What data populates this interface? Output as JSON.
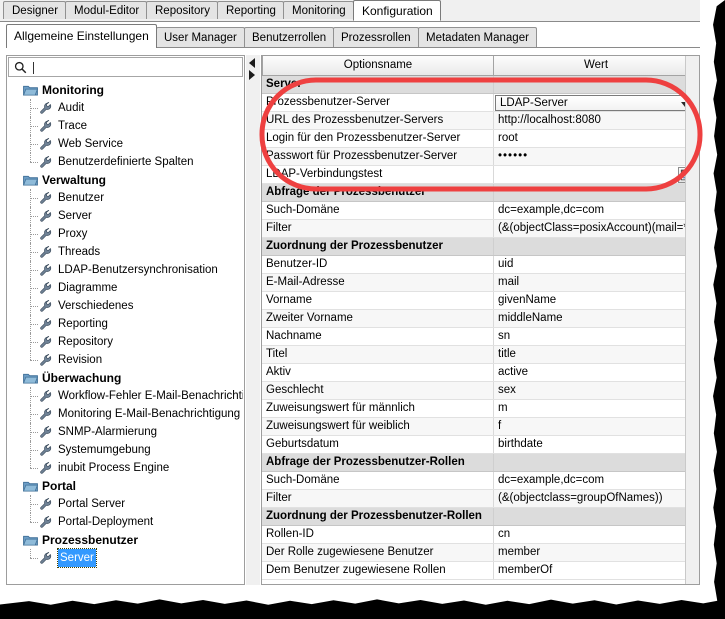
{
  "window": {
    "main_tabs": [
      {
        "label": "Designer",
        "active": false
      },
      {
        "label": "Modul-Editor",
        "active": false
      },
      {
        "label": "Repository",
        "active": false
      },
      {
        "label": "Reporting",
        "active": false
      },
      {
        "label": "Monitoring",
        "active": false
      },
      {
        "label": "Konfiguration",
        "active": true
      }
    ],
    "sub_tabs": [
      {
        "label": "Allgemeine Einstellungen",
        "active": true
      },
      {
        "label": "User Manager",
        "active": false
      },
      {
        "label": "Benutzerrollen",
        "active": false
      },
      {
        "label": "Prozessrollen",
        "active": false
      },
      {
        "label": "Metadaten Manager",
        "active": false
      }
    ]
  },
  "sidebar": {
    "search": {
      "value": "",
      "placeholder": "",
      "icon": "search-icon"
    },
    "splitter": {
      "collapse_left_icon": "triangle-left-icon",
      "collapse_right_icon": "triangle-right-icon"
    },
    "tree": [
      {
        "label": "Monitoring",
        "type": "folder",
        "selected": false
      },
      {
        "label": "Audit",
        "type": "leaf",
        "selected": false
      },
      {
        "label": "Trace",
        "type": "leaf",
        "selected": false
      },
      {
        "label": "Web Service",
        "type": "leaf",
        "selected": false
      },
      {
        "label": "Benutzerdefinierte Spalten",
        "type": "leaf",
        "selected": false
      },
      {
        "label": "Verwaltung",
        "type": "folder",
        "selected": false
      },
      {
        "label": "Benutzer",
        "type": "leaf",
        "selected": false
      },
      {
        "label": "Server",
        "type": "leaf",
        "selected": false
      },
      {
        "label": "Proxy",
        "type": "leaf",
        "selected": false
      },
      {
        "label": "Threads",
        "type": "leaf",
        "selected": false
      },
      {
        "label": "LDAP-Benutzersynchronisation",
        "type": "leaf",
        "selected": false
      },
      {
        "label": "Diagramme",
        "type": "leaf",
        "selected": false
      },
      {
        "label": "Verschiedenes",
        "type": "leaf",
        "selected": false
      },
      {
        "label": "Reporting",
        "type": "leaf",
        "selected": false
      },
      {
        "label": "Repository",
        "type": "leaf",
        "selected": false
      },
      {
        "label": "Revision",
        "type": "leaf",
        "selected": false
      },
      {
        "label": "Überwachung",
        "type": "folder",
        "selected": false
      },
      {
        "label": "Workflow-Fehler E-Mail-Benachrichtigung",
        "type": "leaf",
        "selected": false
      },
      {
        "label": "Monitoring E-Mail-Benachrichtigung",
        "type": "leaf",
        "selected": false
      },
      {
        "label": "SNMP-Alarmierung",
        "type": "leaf",
        "selected": false
      },
      {
        "label": "Systemumgebung",
        "type": "leaf",
        "selected": false
      },
      {
        "label": "inubit Process Engine",
        "type": "leaf",
        "selected": false
      },
      {
        "label": "Portal",
        "type": "folder",
        "selected": false
      },
      {
        "label": "Portal Server",
        "type": "leaf",
        "selected": false
      },
      {
        "label": "Portal-Deployment",
        "type": "leaf",
        "selected": false
      },
      {
        "label": "Prozessbenutzer",
        "type": "folder",
        "selected": false
      },
      {
        "label": "Server",
        "type": "leaf",
        "selected": true
      }
    ]
  },
  "options_table": {
    "columns": [
      "Optionsname",
      "Wert"
    ],
    "rows": [
      {
        "name": "Server",
        "value": "",
        "kind": "group"
      },
      {
        "name": "Prozessbenutzer-Server",
        "value": "LDAP-Server",
        "kind": "combo"
      },
      {
        "name": "URL des Prozessbenutzer-Servers",
        "value": "http://localhost:8080",
        "kind": "text"
      },
      {
        "name": "Login für den Prozessbenutzer-Server",
        "value": "root",
        "kind": "text"
      },
      {
        "name": "Passwort für Prozessbenutzer-Server",
        "value": "••••••",
        "kind": "password"
      },
      {
        "name": "LDAP-Verbindungstest",
        "value": "",
        "kind": "button"
      },
      {
        "name": "Abfrage der Prozessbenutzer",
        "value": "",
        "kind": "group"
      },
      {
        "name": "Such-Domäne",
        "value": "dc=example,dc=com",
        "kind": "text"
      },
      {
        "name": "Filter",
        "value": "(&(objectClass=posixAccount)(mail=*))",
        "kind": "text"
      },
      {
        "name": "Zuordnung der Prozessbenutzer",
        "value": "",
        "kind": "group"
      },
      {
        "name": "Benutzer-ID",
        "value": "uid",
        "kind": "text"
      },
      {
        "name": "E-Mail-Adresse",
        "value": "mail",
        "kind": "text"
      },
      {
        "name": "Vorname",
        "value": "givenName",
        "kind": "text"
      },
      {
        "name": "Zweiter Vorname",
        "value": "middleName",
        "kind": "text"
      },
      {
        "name": "Nachname",
        "value": "sn",
        "kind": "text"
      },
      {
        "name": "Titel",
        "value": "title",
        "kind": "text"
      },
      {
        "name": "Aktiv",
        "value": "active",
        "kind": "text"
      },
      {
        "name": "Geschlecht",
        "value": "sex",
        "kind": "text"
      },
      {
        "name": "Zuweisungswert für männlich",
        "value": "m",
        "kind": "text"
      },
      {
        "name": "Zuweisungswert für weiblich",
        "value": "f",
        "kind": "text"
      },
      {
        "name": "Geburtsdatum",
        "value": "birthdate",
        "kind": "text"
      },
      {
        "name": "Abfrage der Prozessbenutzer-Rollen",
        "value": "",
        "kind": "group"
      },
      {
        "name": "Such-Domäne",
        "value": "dc=example,dc=com",
        "kind": "text"
      },
      {
        "name": "Filter",
        "value": "(&(objectclass=groupOfNames))",
        "kind": "text"
      },
      {
        "name": "Zuordnung der Prozessbenutzer-Rollen",
        "value": "",
        "kind": "group"
      },
      {
        "name": "Rollen-ID",
        "value": "cn",
        "kind": "text"
      },
      {
        "name": "Der Rolle zugewiesene Benutzer",
        "value": "member",
        "kind": "text"
      },
      {
        "name": "Dem Benutzer zugewiesene Rollen",
        "value": "memberOf",
        "kind": "text"
      }
    ]
  },
  "annotation": {
    "shape": "rounded-rectangle",
    "color": "#ee4040"
  },
  "colors": {
    "selection": "#3399ff",
    "group_row": "#dcdcdc",
    "annotation_red": "#ee4040",
    "window_bg": "#f0f0f0"
  }
}
